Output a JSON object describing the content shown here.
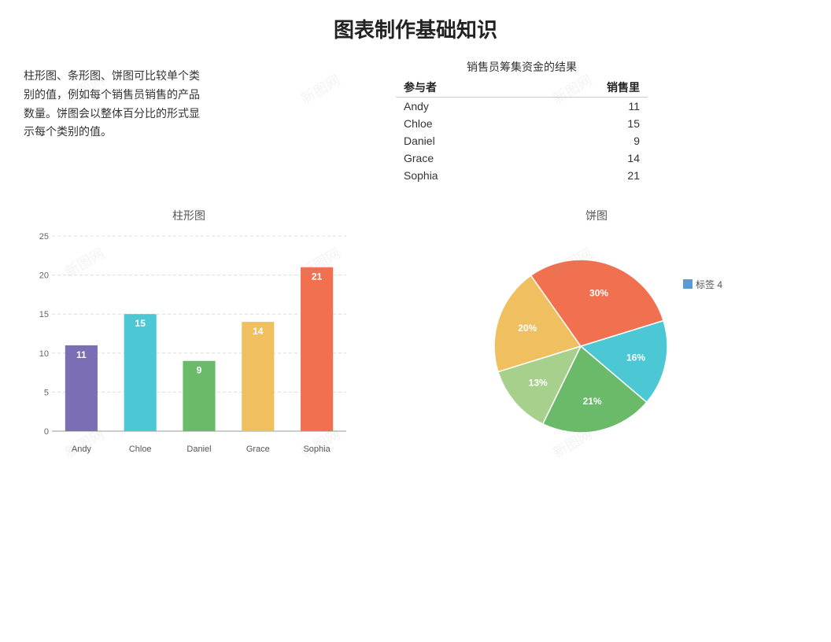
{
  "page": {
    "title": "图表制作基础知识"
  },
  "description": {
    "text": "柱形图、条形图、饼图可比较单个类别的值，例如每个销售员销售的产品数量。饼图会以整体百分比的形式显示每个类别的值。"
  },
  "table": {
    "title": "销售员筹集资金的结果",
    "col_participant": "参与者",
    "col_sales": "销售里",
    "rows": [
      {
        "name": "Andy",
        "value": "11"
      },
      {
        "name": "Chloe",
        "value": "15"
      },
      {
        "name": "Daniel",
        "value": "9"
      },
      {
        "name": "Grace",
        "value": "14"
      },
      {
        "name": "Sophia",
        "value": "21"
      }
    ]
  },
  "bar_chart": {
    "title": "柱形图",
    "y_labels": [
      "25",
      "20",
      "15",
      "10",
      "5",
      "0"
    ],
    "bars": [
      {
        "name": "Andy",
        "value": 11,
        "label": "11",
        "color": "#7b6eb5"
      },
      {
        "name": "Chloe",
        "value": 15,
        "label": "15",
        "color": "#4bc8d4"
      },
      {
        "name": "Daniel",
        "value": 9,
        "label": "9",
        "color": "#6aba6a"
      },
      {
        "name": "Grace",
        "value": 14,
        "label": "14",
        "color": "#f0c060"
      },
      {
        "name": "Sophia",
        "value": 21,
        "label": "21",
        "color": "#f07050"
      }
    ],
    "max_value": 25
  },
  "pie_chart": {
    "title": "饼图",
    "legend_label": "标签  4",
    "legend_color": "#5b9bd5",
    "slices": [
      {
        "label": "16%",
        "percent": 16,
        "color": "#4bc8d4"
      },
      {
        "label": "21%",
        "percent": 21,
        "color": "#6aba6a"
      },
      {
        "label": "13%",
        "percent": 13,
        "color": "#a8d08d"
      },
      {
        "label": "20%",
        "percent": 20,
        "color": "#f0c060"
      },
      {
        "label": "30%",
        "percent": 30,
        "color": "#f07050"
      }
    ]
  },
  "watermark": "新图网"
}
